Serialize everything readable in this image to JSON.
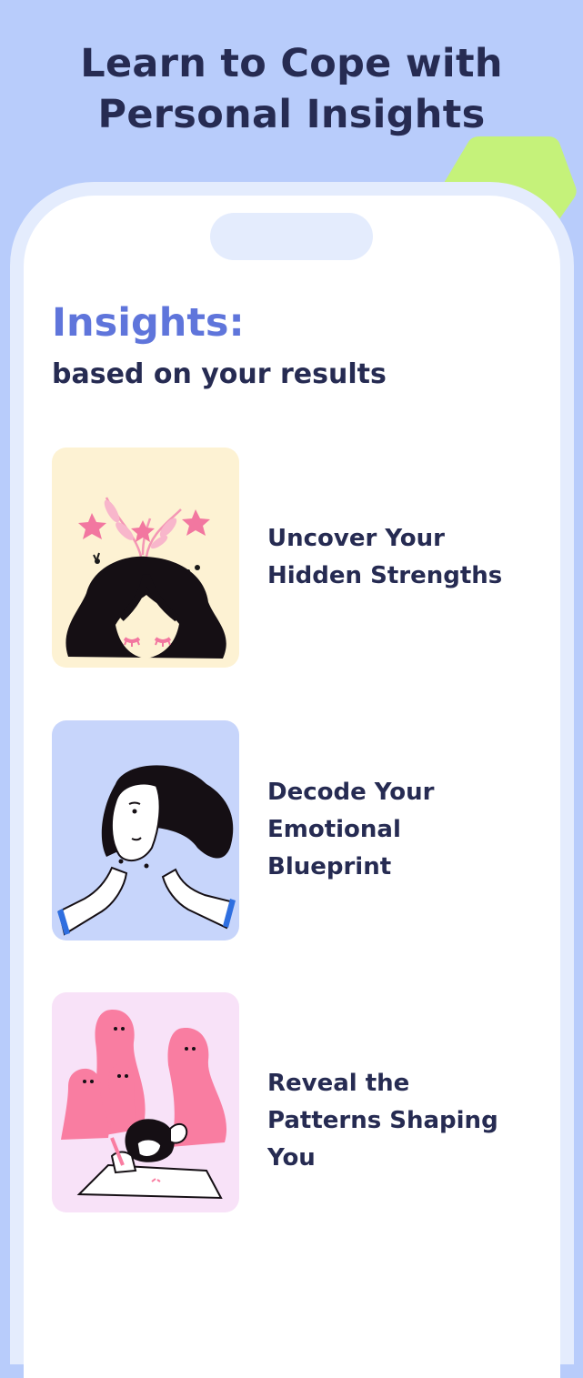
{
  "headline": {
    "line1": "Learn to Cope with",
    "line2": "Personal Insights"
  },
  "insights": {
    "title": "Insights:",
    "subtitle": "based on your results"
  },
  "cards": [
    {
      "lines": [
        "Uncover Your",
        "Hidden Strengths"
      ],
      "bg": "#fdf2d3",
      "illustration": "woman-head-stars"
    },
    {
      "lines": [
        "Decode Your",
        "Emotional",
        "Blueprint"
      ],
      "bg": "#c7d5fb",
      "illustration": "woman-framing-hands"
    },
    {
      "lines": [
        "Reveal the",
        "Patterns Shaping",
        "You"
      ],
      "bg": "#f8e2f8",
      "illustration": "woman-with-shadow-figures"
    }
  ],
  "colors": {
    "background": "#b8ccfb",
    "headline": "#262b52",
    "accent": "#5f75db",
    "lime": "#c5f27a",
    "pink": "#f97da1"
  }
}
